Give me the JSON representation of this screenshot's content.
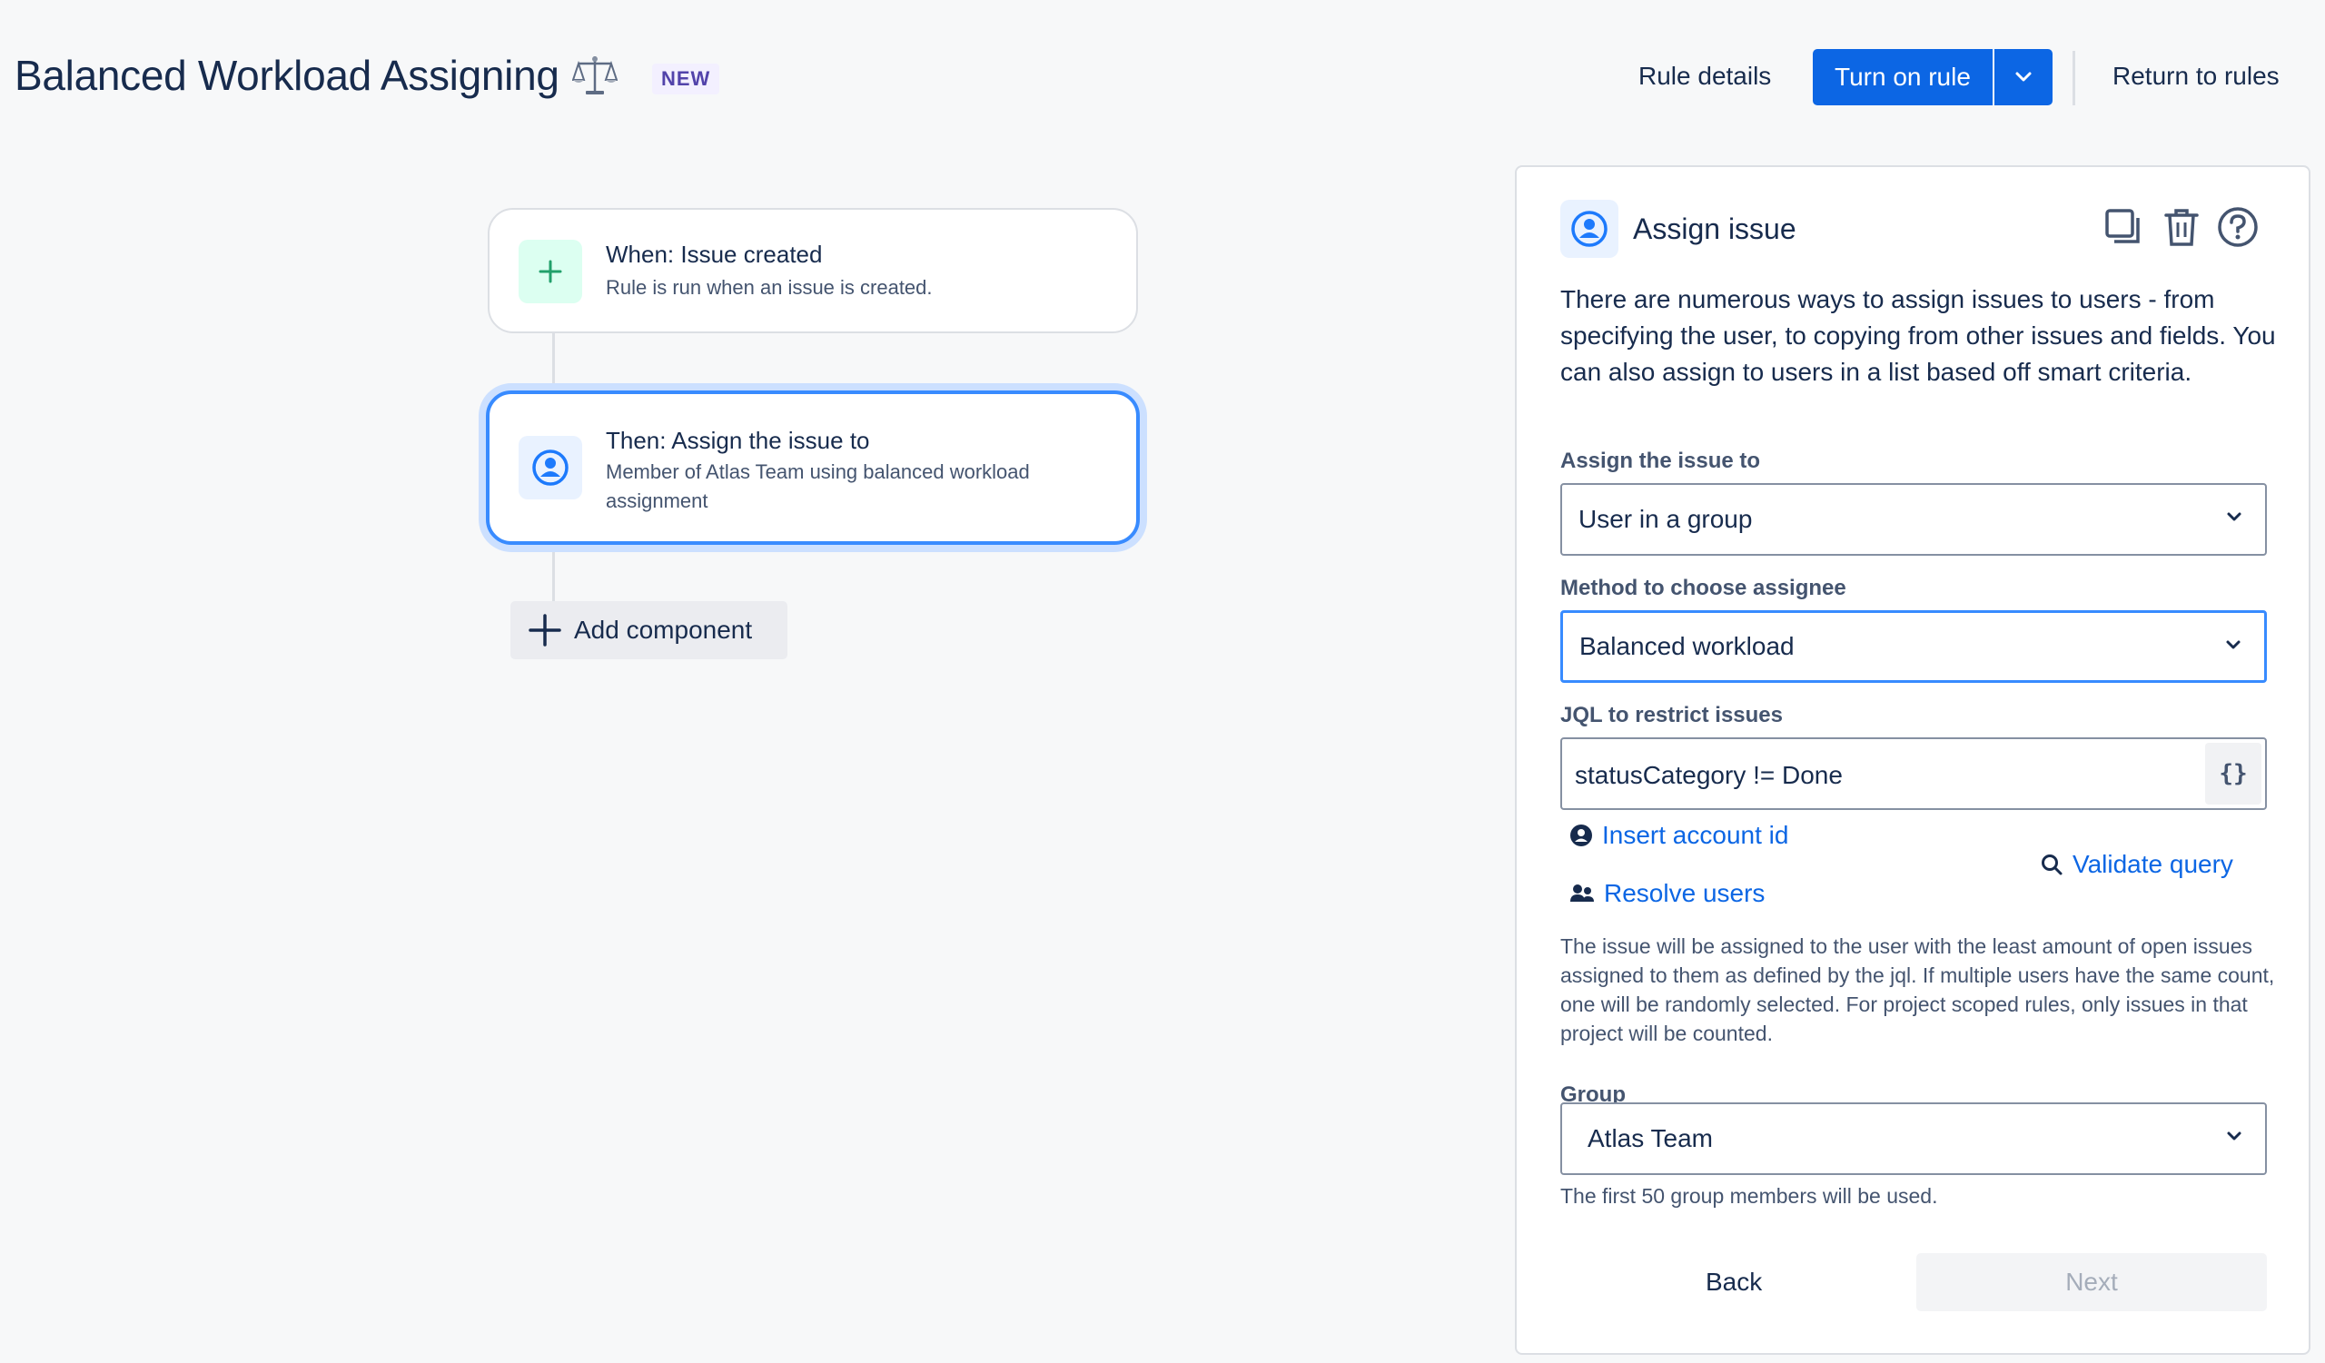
{
  "header": {
    "title": "Balanced Workload Assigning",
    "title_icon": "scales-icon",
    "badge": "NEW",
    "rule_details": "Rule details",
    "turn_on": "Turn on rule",
    "return": "Return to rules"
  },
  "flow": {
    "trigger": {
      "title": "When: Issue created",
      "subtitle": "Rule is run when an issue is created.",
      "icon": "plus-icon"
    },
    "action": {
      "title": "Then: Assign the issue to",
      "subtitle": "Member of Atlas Team using balanced workload assignment",
      "icon": "user-avatar-icon"
    },
    "add_component": "Add component"
  },
  "panel": {
    "title": "Assign issue",
    "description": "There are numerous ways to assign issues to users - from specifying the user, to copying from other issues and fields. You can also assign to users in a list based off smart criteria.",
    "assign_label": "Assign the issue to",
    "assign_value": "User in a group",
    "method_label": "Method to choose assignee",
    "method_value": "Balanced workload",
    "jql_label": "JQL to restrict issues",
    "jql_value": "statusCategory != Done",
    "jql_button": "{}",
    "insert_account": "Insert account id",
    "resolve_users": "Resolve users",
    "validate_query": "Validate query",
    "help_text": "The issue will be assigned to the user with the least amount of open issues assigned to them as defined by the jql. If multiple users have the same count, one will be randomly selected. For project scoped rules, only issues in that project will be counted.",
    "group_label": "Group",
    "group_value": "Atlas Team",
    "group_note": "The first 50 group members will be used.",
    "back": "Back",
    "next": "Next"
  },
  "colors": {
    "primary": "#0c66e4",
    "focus": "#388bff",
    "text": "#172b4d",
    "subtle_text": "#44546f"
  }
}
